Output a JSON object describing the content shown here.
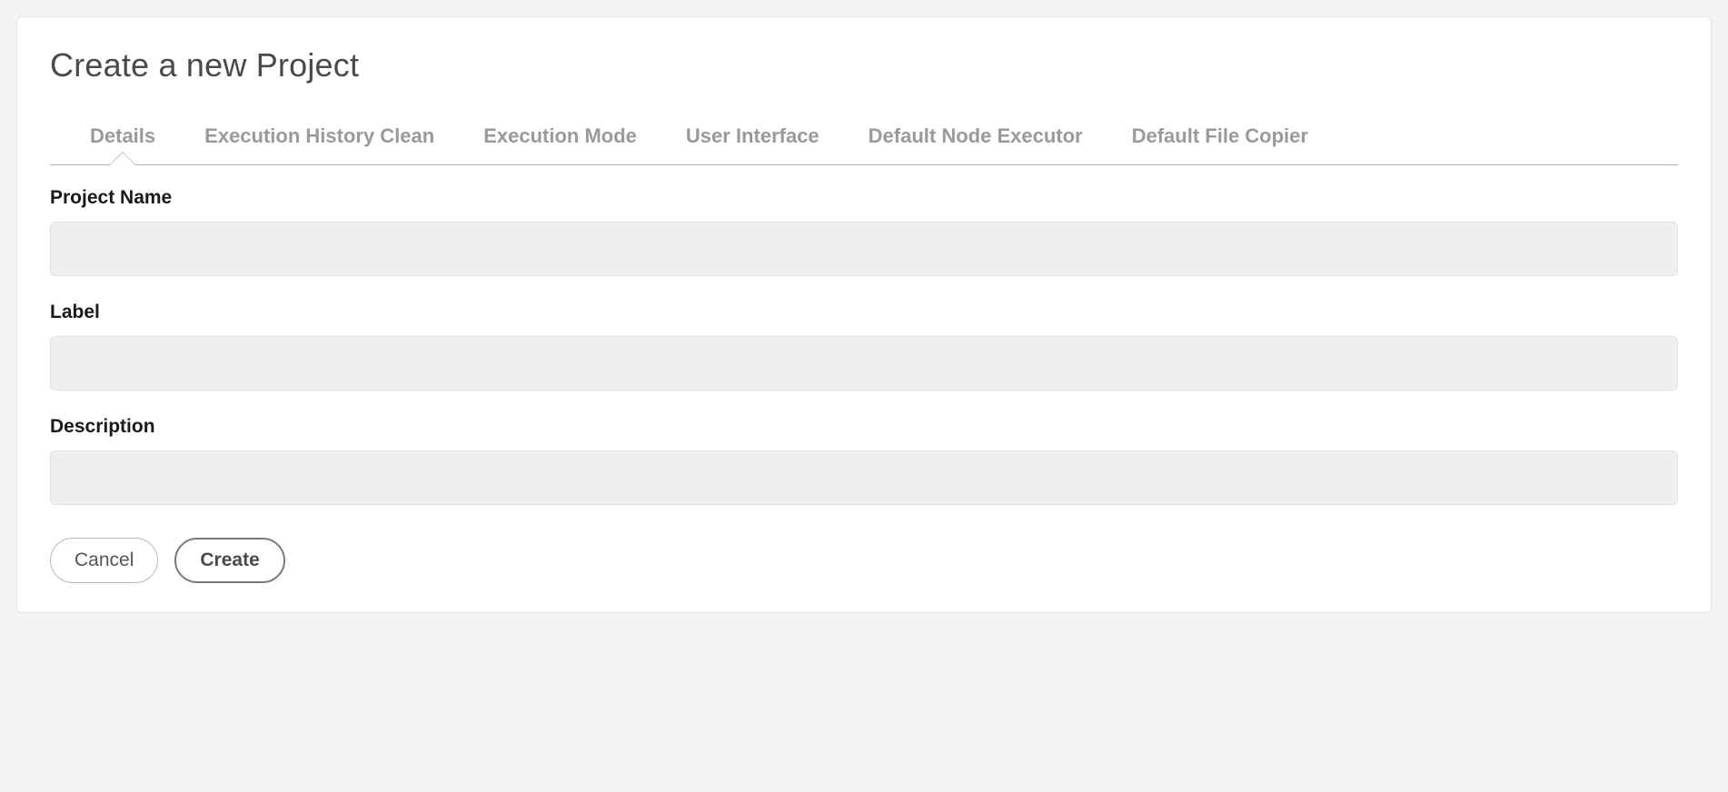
{
  "header": {
    "title": "Create a new Project"
  },
  "tabs": [
    {
      "label": "Details",
      "active": true
    },
    {
      "label": "Execution History Clean",
      "active": false
    },
    {
      "label": "Execution Mode",
      "active": false
    },
    {
      "label": "User Interface",
      "active": false
    },
    {
      "label": "Default Node Executor",
      "active": false
    },
    {
      "label": "Default File Copier",
      "active": false
    }
  ],
  "form": {
    "projectName": {
      "label": "Project Name",
      "value": ""
    },
    "label": {
      "label": "Label",
      "value": ""
    },
    "description": {
      "label": "Description",
      "value": ""
    }
  },
  "buttons": {
    "cancel": "Cancel",
    "create": "Create"
  }
}
